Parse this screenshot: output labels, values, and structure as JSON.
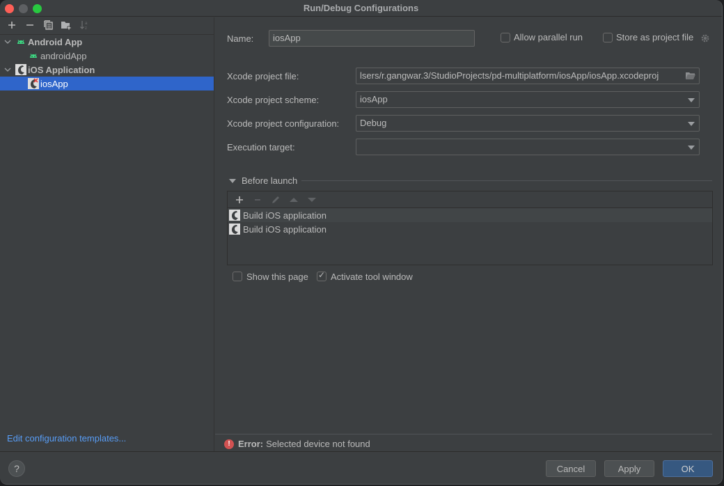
{
  "window": {
    "title": "Run/Debug Configurations"
  },
  "sidebar": {
    "toolbar": [
      {
        "name": "add-config-button",
        "icon": "+",
        "enabled": true
      },
      {
        "name": "remove-config-button",
        "icon": "−",
        "enabled": true
      },
      {
        "name": "copy-config-button",
        "icon": "copy",
        "enabled": true
      },
      {
        "name": "new-folder-button",
        "icon": "folder-plus",
        "enabled": true
      },
      {
        "name": "sort-button",
        "icon": "sort-az",
        "enabled": false
      }
    ],
    "tree": [
      {
        "label": "Android App",
        "type": "group",
        "icon": "android-icon",
        "expanded": true
      },
      {
        "label": "androidApp",
        "type": "item",
        "icon": "android-icon"
      },
      {
        "label": "iOS Application",
        "type": "group",
        "icon": "xcode-icon",
        "expanded": true
      },
      {
        "label": "iosApp",
        "type": "item",
        "icon": "xcode-error-icon",
        "selected": true
      }
    ],
    "edit_templates_link": "Edit configuration templates..."
  },
  "form": {
    "name_label": "Name:",
    "name_value": "iosApp",
    "allow_parallel_label": "Allow parallel run",
    "allow_parallel_checked": false,
    "store_project_label": "Store as project file",
    "store_project_checked": false,
    "xcode_project_file_label": "Xcode project file:",
    "xcode_project_file_value": "lsers/r.gangwar.3/StudioProjects/pd-multiplatform/iosApp/iosApp.xcodeproj",
    "xcode_scheme_label": "Xcode project scheme:",
    "xcode_scheme_value": "iosApp",
    "xcode_config_label": "Xcode project configuration:",
    "xcode_config_value": "Debug",
    "execution_target_label": "Execution target:",
    "execution_target_value": ""
  },
  "before_launch": {
    "title": "Before launch",
    "tasks": [
      {
        "label": "Build iOS application"
      },
      {
        "label": "Build iOS application"
      }
    ],
    "show_this_page_label": "Show this page",
    "show_this_page_checked": false,
    "activate_tool_window_label": "Activate tool window",
    "activate_tool_window_checked": true
  },
  "error": {
    "prefix": "Error:",
    "message": "Selected device not found"
  },
  "footer": {
    "help": "?",
    "cancel": "Cancel",
    "apply": "Apply",
    "ok": "OK"
  },
  "colors": {
    "accent": "#2f65ca",
    "primary_button": "#365880",
    "link": "#589df6",
    "error": "#d25252",
    "android_green": "#3ddc84"
  }
}
